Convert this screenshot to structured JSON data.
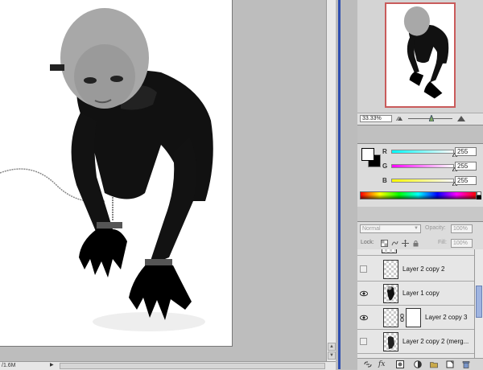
{
  "status": {
    "zoom": "33.33%",
    "doc_info": "/1.6M"
  },
  "navigator": {
    "zoom_value": "33.33%"
  },
  "color": {
    "channels": [
      {
        "label": "R",
        "value": "255",
        "gradient": [
          "#00ffff",
          "#ffffff"
        ]
      },
      {
        "label": "G",
        "value": "255",
        "gradient": [
          "#ff00ff",
          "#ffffff"
        ]
      },
      {
        "label": "B",
        "value": "255",
        "gradient": [
          "#ffff00",
          "#ffffff"
        ]
      }
    ]
  },
  "layers": {
    "blend_mode": "Normal",
    "opacity_label": "Opacity:",
    "opacity_value": "100%",
    "lock_label": "Lock:",
    "fill_label": "Fill:",
    "fill_value": "100%",
    "items": [
      {
        "name": "Layer 2 copy 2",
        "visible": false
      },
      {
        "name": "Layer 1 copy",
        "visible": true
      },
      {
        "name": "Layer 2 copy 3",
        "visible": true
      },
      {
        "name": "Layer 2 copy 2 (merg...",
        "visible": false
      }
    ]
  }
}
